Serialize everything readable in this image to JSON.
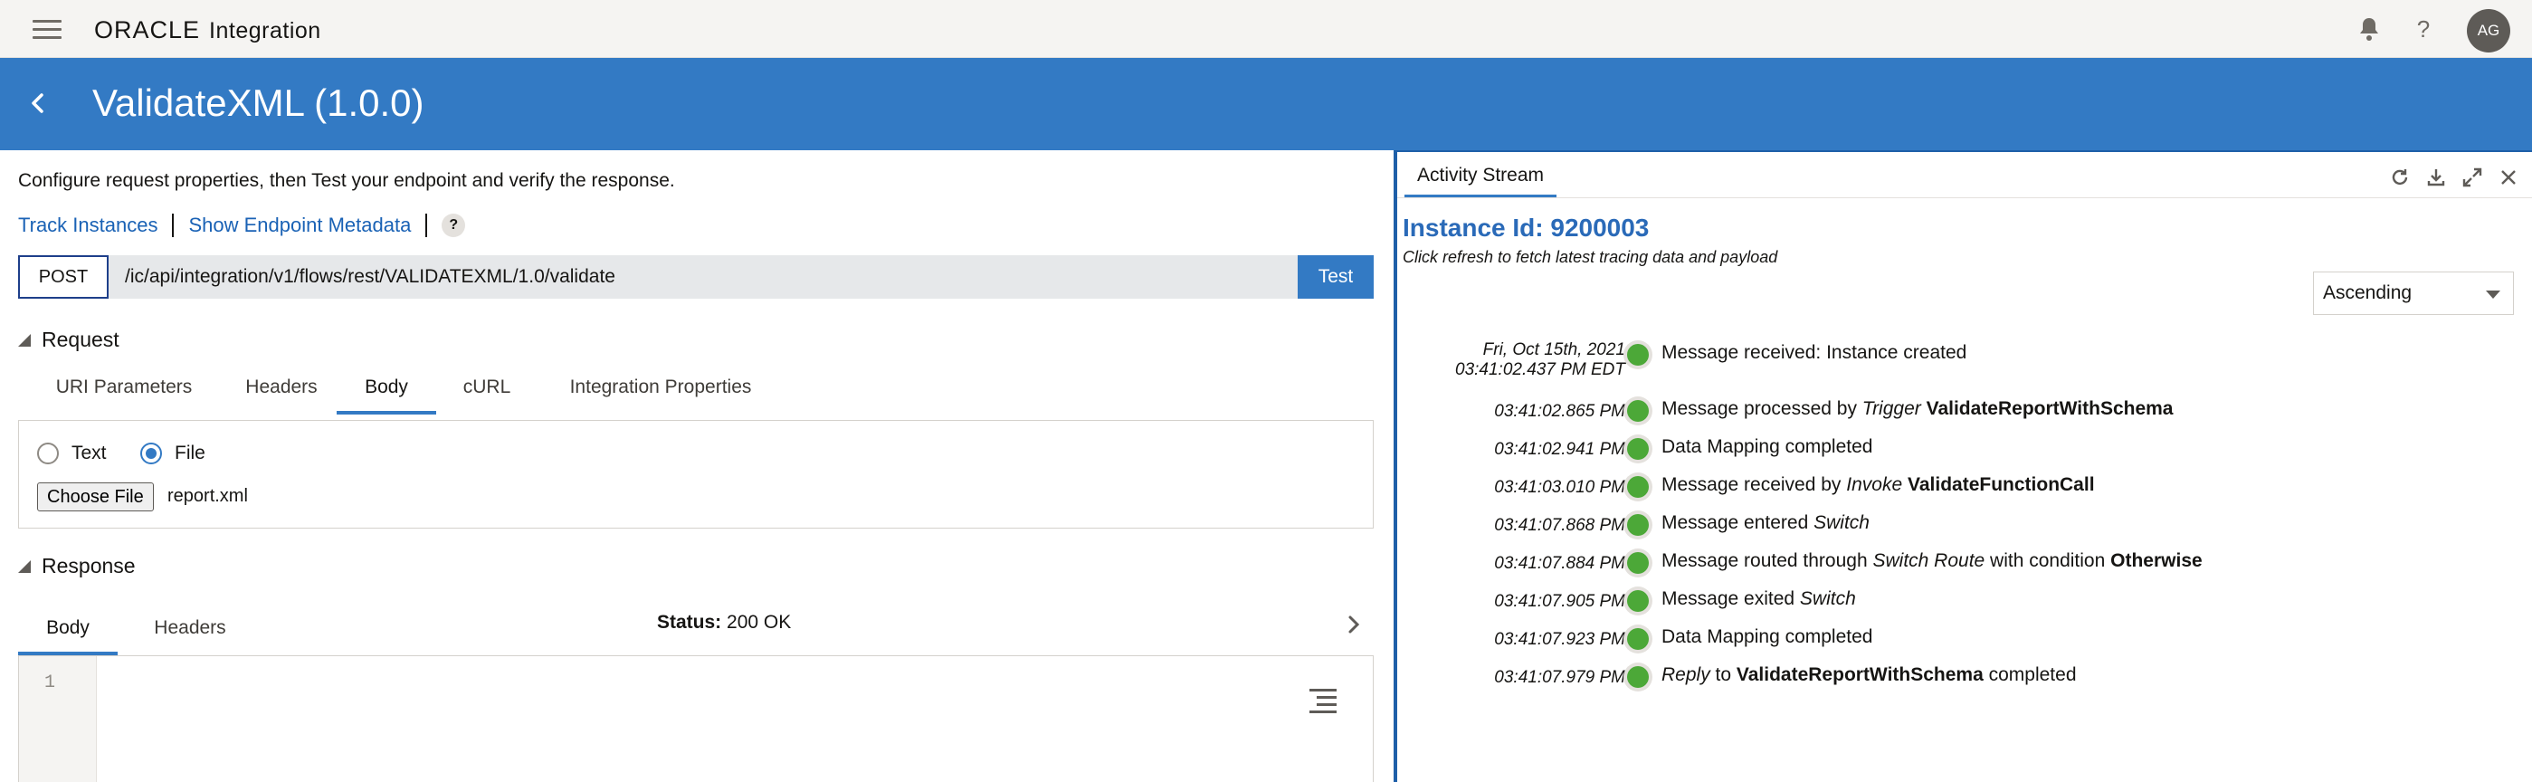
{
  "app": {
    "brand": "ORACLE",
    "product": "Integration",
    "user_initials": "AG"
  },
  "header": {
    "title": "ValidateXML (1.0.0)"
  },
  "left": {
    "intro": "Configure request properties, then Test your endpoint and verify the response.",
    "links": {
      "track": "Track Instances",
      "metadata": "Show Endpoint Metadata",
      "help": "?"
    },
    "request": {
      "method": "POST",
      "url": "/ic/api/integration/v1/flows/rest/VALIDATEXML/1.0/validate",
      "test_label": "Test",
      "section_label": "Request",
      "tabs": [
        {
          "label": "URI Parameters"
        },
        {
          "label": "Headers"
        },
        {
          "label": "Body"
        },
        {
          "label": "cURL"
        },
        {
          "label": "Integration Properties"
        }
      ],
      "active_tab": "Body",
      "body": {
        "radio_text": "Text",
        "radio_file": "File",
        "selected": "File",
        "choose_file": "Choose File",
        "filename": "report.xml"
      }
    },
    "response": {
      "section_label": "Response",
      "tabs": [
        {
          "label": "Body"
        },
        {
          "label": "Headers"
        }
      ],
      "active_tab": "Body",
      "status_label": "Status:",
      "status_value": "200 OK",
      "line_number": "1"
    }
  },
  "activity": {
    "tab_label": "Activity Stream",
    "instance_id": "Instance Id: 9200003",
    "hint": "Click refresh to fetch latest tracing data and payload",
    "sort": "Ascending",
    "events": [
      {
        "time": "Fri, Oct 15th, 2021",
        "time2": "03:41:02.437 PM EDT",
        "parts": [
          {
            "t": "Message received: Instance created",
            "s": "n"
          }
        ]
      },
      {
        "time": "03:41:02.865 PM",
        "parts": [
          {
            "t": "Message processed by ",
            "s": "n"
          },
          {
            "t": "Trigger",
            "s": "i"
          },
          {
            "t": " ",
            "s": "n"
          },
          {
            "t": "ValidateReportWithSchema",
            "s": "b"
          }
        ]
      },
      {
        "time": "03:41:02.941 PM",
        "parts": [
          {
            "t": "Data Mapping completed",
            "s": "n"
          }
        ]
      },
      {
        "time": "03:41:03.010 PM",
        "parts": [
          {
            "t": "Message received by ",
            "s": "n"
          },
          {
            "t": "Invoke",
            "s": "i"
          },
          {
            "t": " ",
            "s": "n"
          },
          {
            "t": "ValidateFunctionCall",
            "s": "b"
          }
        ]
      },
      {
        "time": "03:41:07.868 PM",
        "parts": [
          {
            "t": "Message entered ",
            "s": "n"
          },
          {
            "t": "Switch",
            "s": "i"
          }
        ]
      },
      {
        "time": "03:41:07.884 PM",
        "parts": [
          {
            "t": "Message routed through ",
            "s": "n"
          },
          {
            "t": "Switch Route",
            "s": "i"
          },
          {
            "t": " with condition ",
            "s": "n"
          },
          {
            "t": "Otherwise",
            "s": "b"
          }
        ]
      },
      {
        "time": "03:41:07.905 PM",
        "parts": [
          {
            "t": "Message exited ",
            "s": "n"
          },
          {
            "t": "Switch",
            "s": "i"
          }
        ]
      },
      {
        "time": "03:41:07.923 PM",
        "parts": [
          {
            "t": "Data Mapping completed",
            "s": "n"
          }
        ]
      },
      {
        "time": "03:41:07.979 PM",
        "parts": [
          {
            "t": "Reply",
            "s": "i"
          },
          {
            "t": " to ",
            "s": "n"
          },
          {
            "t": "ValidateReportWithSchema",
            "s": "b"
          },
          {
            "t": " completed",
            "s": "n"
          }
        ]
      }
    ]
  },
  "colors": {
    "header_blue": "#337ac4",
    "success_green": "#4ca838",
    "link_blue": "#1a62b5"
  }
}
